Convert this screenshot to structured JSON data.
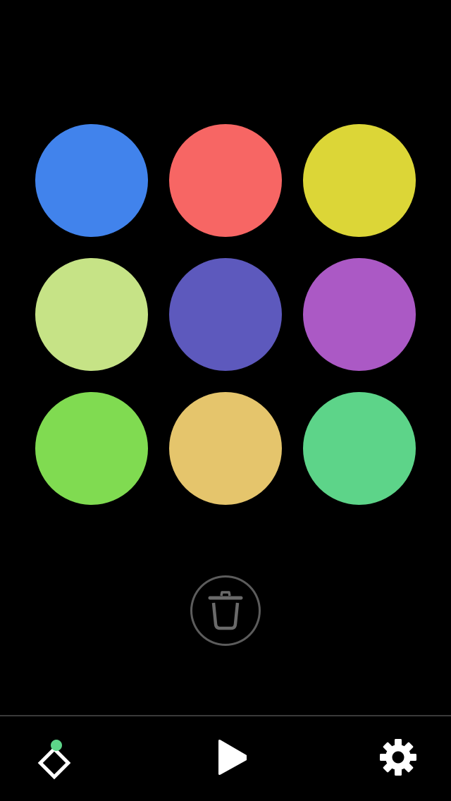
{
  "pads": [
    {
      "name": "pad-blue",
      "color": "#4183ec"
    },
    {
      "name": "pad-coral",
      "color": "#f76664"
    },
    {
      "name": "pad-yellow",
      "color": "#dcd637"
    },
    {
      "name": "pad-light-green",
      "color": "#c6e386"
    },
    {
      "name": "pad-indigo",
      "color": "#5d59bd"
    },
    {
      "name": "pad-purple",
      "color": "#ab59c5"
    },
    {
      "name": "pad-green",
      "color": "#80db51"
    },
    {
      "name": "pad-amber",
      "color": "#e5c56c"
    },
    {
      "name": "pad-mint",
      "color": "#5dd489"
    }
  ],
  "trash": {
    "icon": "trash-icon",
    "color": "#6a6a6a"
  },
  "tab_bar": {
    "items": [
      {
        "name": "pads-tab",
        "icon": "diamond-icon",
        "active": true,
        "indicator_color": "#5dd489"
      },
      {
        "name": "play-tab",
        "icon": "play-icon",
        "active": false
      },
      {
        "name": "settings-tab",
        "icon": "gear-icon",
        "active": false
      }
    ],
    "icon_color": "#ffffff"
  }
}
